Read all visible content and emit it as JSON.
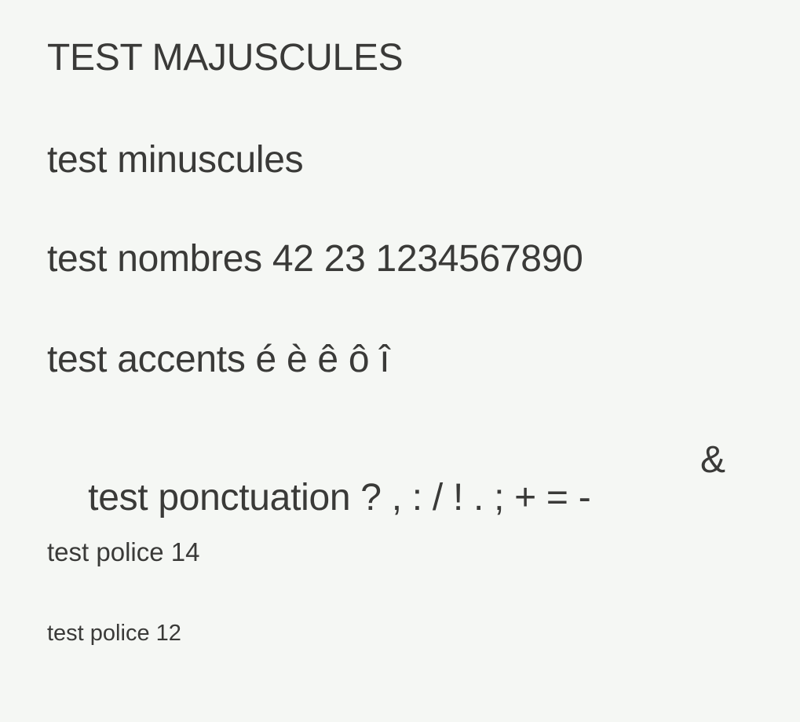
{
  "lines": {
    "uppercase": "TEST MAJUSCULES",
    "lowercase": "test minuscules",
    "numbers": "test nombres 42 23 1234567890",
    "accents": "test accents é è ê ô î",
    "punctuation": "test ponctuation ? , : / ! . ; + = -",
    "ampersand": "&",
    "font14": "test police 14",
    "font12": "test police 12"
  }
}
